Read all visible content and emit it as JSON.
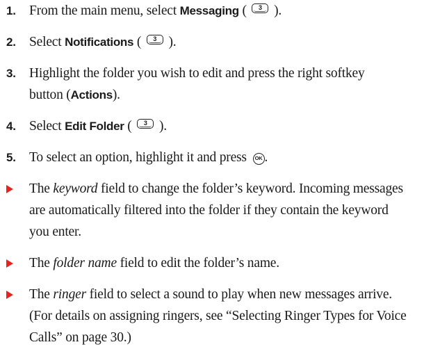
{
  "steps": [
    {
      "num": "1.",
      "text_before": "From the main menu, select ",
      "bold": "Messaging",
      "open_paren": " (",
      "key": "3",
      "after": ")."
    },
    {
      "num": "2.",
      "text_before": "Select ",
      "bold": "Notifications",
      "open_paren": " (",
      "key": "3",
      "after": ")."
    },
    {
      "num": "3.",
      "line1": "Highlight the folder you wish to edit and press the right softkey",
      "line2_before": "button (",
      "bold": "Actions",
      "after": ")."
    },
    {
      "num": "4.",
      "text_before": "Select ",
      "bold": "Edit Folder",
      "open_paren": " (",
      "key": "3",
      "after": ")."
    },
    {
      "num": "5.",
      "text_before": "To select an option, highlight it and press ",
      "ok_key": "OK",
      "after": "."
    }
  ],
  "bullets": [
    {
      "before": "The ",
      "italic": "keyword",
      "line1_after": " field to change the folder’s keyword. Incoming messages",
      "line2": "are automatically filtered into the folder if they contain the keyword",
      "line3": "you enter."
    },
    {
      "before": "The ",
      "italic": "folder name",
      "after": " field to edit the folder’s name."
    },
    {
      "before": "The ",
      "italic": "ringer",
      "line1_after": " field to select a sound to play when new messages arrive.",
      "line2": "(For details on assigning ringers, see “Selecting Ringer Types for Voice",
      "line3": "Calls” on page 30.)"
    }
  ],
  "colors": {
    "bullet_arrow": "#e8231e",
    "text": "#1a1a1a"
  }
}
